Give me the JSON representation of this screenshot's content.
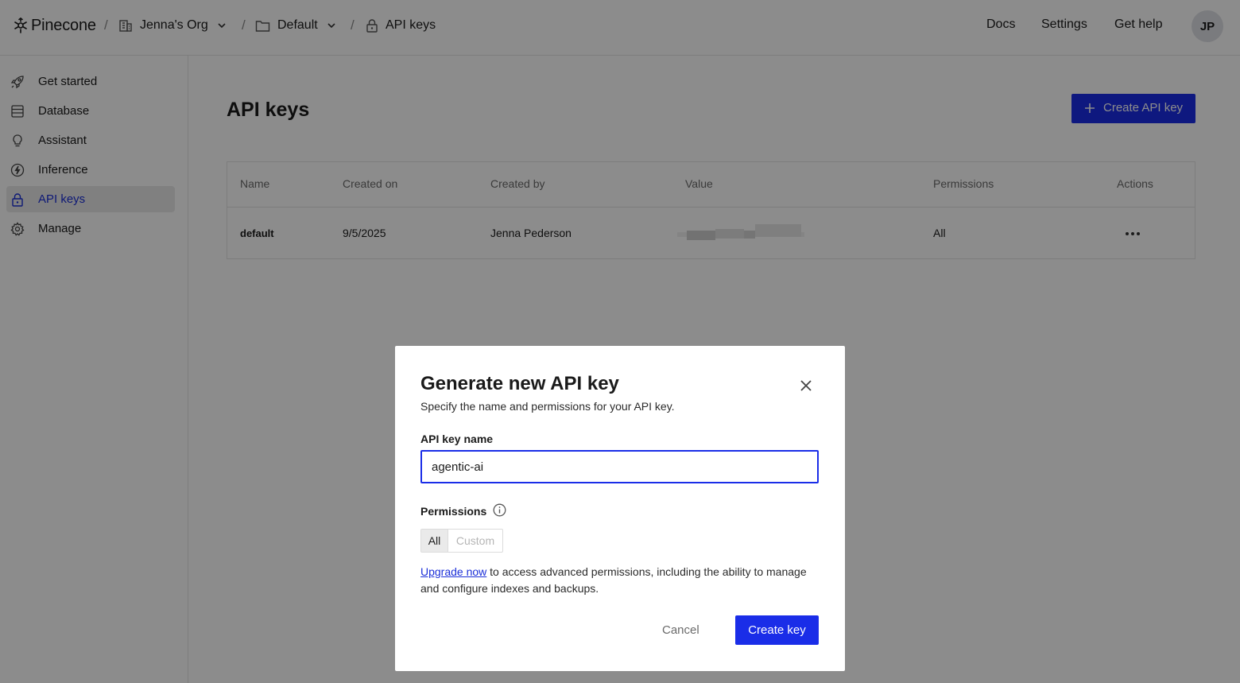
{
  "app": {
    "logo_text": "Pinecone"
  },
  "header": {
    "breadcrumbs": [
      {
        "label": "Jenna's Org",
        "icon": "building-icon"
      },
      {
        "label": "Default",
        "icon": "folder-icon"
      },
      {
        "label": "API keys",
        "icon": "lock-icon"
      }
    ],
    "separator": "/",
    "nav": {
      "docs": "Docs",
      "settings": "Settings",
      "help": "Get help"
    },
    "avatar_initials": "JP"
  },
  "sidebar": {
    "items": [
      {
        "label": "Get started",
        "icon": "rocket-icon"
      },
      {
        "label": "Database",
        "icon": "database-icon"
      },
      {
        "label": "Assistant",
        "icon": "lightbulb-icon"
      },
      {
        "label": "Inference",
        "icon": "lightning-icon"
      },
      {
        "label": "API keys",
        "icon": "lock-icon",
        "active": true
      },
      {
        "label": "Manage",
        "icon": "gear-icon"
      }
    ]
  },
  "main": {
    "title": "API keys",
    "create_button": "Create API key",
    "table": {
      "columns": [
        "Name",
        "Created on",
        "Created by",
        "Value",
        "Permissions",
        "Actions"
      ],
      "rows": [
        {
          "name": "default",
          "created_on": "9/5/2025",
          "created_by": "Jenna Pederson",
          "permissions": "All"
        }
      ]
    }
  },
  "modal": {
    "title": "Generate new API key",
    "subtitle": "Specify the name and permissions for your API key.",
    "name_label": "API key name",
    "name_value": "agentic-ai",
    "permissions_label": "Permissions",
    "permission_options": {
      "all": "All",
      "custom": "Custom",
      "selected": "All"
    },
    "upgrade_link": "Upgrade now",
    "upgrade_text": " to access advanced permissions, including the ability to manage and configure indexes and backups.",
    "cancel": "Cancel",
    "create": "Create key"
  },
  "colors": {
    "accent": "#1a2de8",
    "overlay": "rgba(0,0,0,0.45)"
  }
}
